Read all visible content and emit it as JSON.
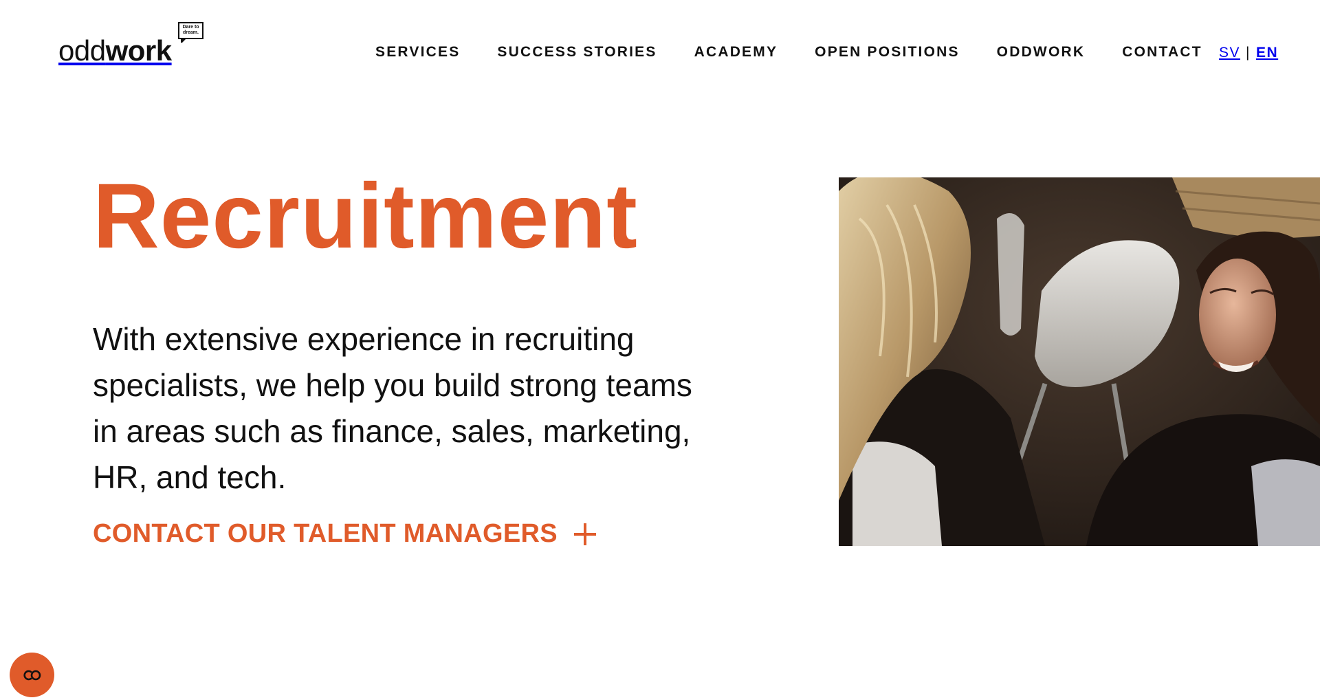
{
  "brand": {
    "logo_light": "odd",
    "logo_bold": "work",
    "tagline": "Dare to dream.",
    "accent_color": "#e05b2a"
  },
  "nav": {
    "items": [
      {
        "label": "SERVICES",
        "active": true
      },
      {
        "label": "SUCCESS STORIES",
        "active": false
      },
      {
        "label": "ACADEMY",
        "active": false
      },
      {
        "label": "OPEN POSITIONS",
        "active": false
      },
      {
        "label": "ODDWORK",
        "active": false
      },
      {
        "label": "CONTACT",
        "active": false
      }
    ]
  },
  "language": {
    "sv": "SV",
    "separator": "|",
    "en": "EN",
    "selected": "EN"
  },
  "hero": {
    "title": "Recruitment",
    "description": "With extensive experience in recruiting specialists, we help you build strong teams in areas such as finance, sales, marketing, HR, and tech.",
    "cta_label": "CONTACT OUR TALENT MANAGERS",
    "cta_icon": "plus-icon",
    "image_icon": "photo-two-women-talking"
  },
  "consent": {
    "icon": "cookie-consent-icon"
  }
}
